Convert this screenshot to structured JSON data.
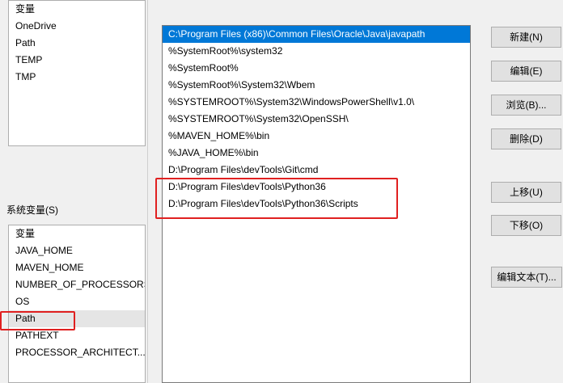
{
  "user_vars": {
    "header": "变量",
    "items": [
      "OneDrive",
      "Path",
      "TEMP",
      "TMP"
    ]
  },
  "system_vars": {
    "group_label": "系统变量(S)",
    "header": "变量",
    "items": [
      "JAVA_HOME",
      "MAVEN_HOME",
      "NUMBER_OF_PROCESSORS",
      "OS",
      "Path",
      "PATHEXT",
      "PROCESSOR_ARCHITECT..."
    ],
    "selected_index": 4
  },
  "edit_dialog": {
    "paths": [
      "C:\\Program Files (x86)\\Common Files\\Oracle\\Java\\javapath",
      "%SystemRoot%\\system32",
      "%SystemRoot%",
      "%SystemRoot%\\System32\\Wbem",
      "%SYSTEMROOT%\\System32\\WindowsPowerShell\\v1.0\\",
      "%SYSTEMROOT%\\System32\\OpenSSH\\",
      "%MAVEN_HOME%\\bin",
      "%JAVA_HOME%\\bin",
      "D:\\Program Files\\devTools\\Git\\cmd",
      "D:\\Program Files\\devTools\\Python36",
      "D:\\Program Files\\devTools\\Python36\\Scripts"
    ],
    "selected_index": 0,
    "buttons": {
      "new": "新建(N)",
      "edit": "编辑(E)",
      "browse": "浏览(B)...",
      "delete": "删除(D)",
      "move_up": "上移(U)",
      "move_down": "下移(O)",
      "edit_text": "编辑文本(T)..."
    }
  },
  "colors": {
    "selection": "#0078d7",
    "annotation": "#e02020"
  }
}
